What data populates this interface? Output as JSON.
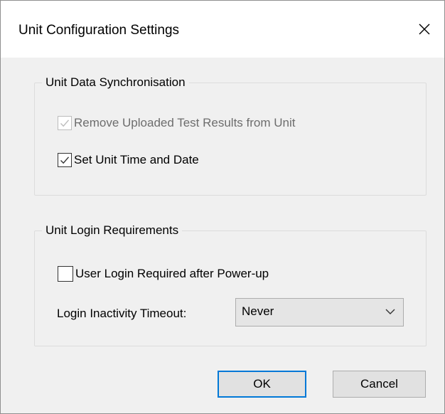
{
  "window": {
    "title": "Unit Configuration Settings",
    "close_icon": "close-icon",
    "close_glyph": "✕"
  },
  "sync_group": {
    "legend": "Unit Data Synchronisation",
    "remove_uploaded": {
      "label": "Remove Uploaded Test Results from Unit",
      "checked": true,
      "enabled": false
    },
    "set_time_date": {
      "label": "Set Unit Time and Date",
      "checked": true,
      "enabled": true
    }
  },
  "login_group": {
    "legend": "Unit Login Requirements",
    "login_required": {
      "label": "User Login Required after Power-up",
      "checked": false,
      "enabled": true
    },
    "timeout_label": "Login Inactivity Timeout:",
    "timeout_value": "Never",
    "timeout_icon": "chevron-down-icon"
  },
  "buttons": {
    "ok": "OK",
    "cancel": "Cancel"
  },
  "colors": {
    "dialog_bg": "#f0f0f0",
    "titlebar_bg": "#ffffff",
    "default_button_border": "#0078d7",
    "disabled_text": "#6d6d6d"
  }
}
